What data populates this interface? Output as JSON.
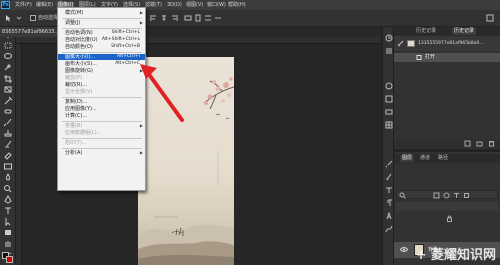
{
  "app": {
    "logo": "Ps"
  },
  "menubar": {
    "items": [
      "文件(F)",
      "编辑(E)",
      "图像(I)",
      "图层(L)",
      "文字(Y)",
      "选择(S)",
      "滤镜(T)",
      "3D(D)",
      "视图(V)",
      "窗口(W)",
      "帮助(H)"
    ],
    "active_index": 2
  },
  "options_bar": {
    "auto_select_label": "自动选择"
  },
  "document": {
    "tab_title": "8365577e81af96633..."
  },
  "image_menu": {
    "items": [
      {
        "label": "模式(M)",
        "shortcut": "",
        "submenu": true,
        "disabled": false
      },
      {
        "separator": true
      },
      {
        "label": "调整(J)",
        "shortcut": "",
        "submenu": true,
        "disabled": false
      },
      {
        "separator": true
      },
      {
        "label": "自动色调(N)",
        "shortcut": "Shift+Ctrl+L",
        "disabled": false
      },
      {
        "label": "自动对比度(U)",
        "shortcut": "Alt+Shift+Ctrl+L",
        "disabled": false
      },
      {
        "label": "自动颜色(O)",
        "shortcut": "Shift+Ctrl+B",
        "disabled": false
      },
      {
        "separator": true
      },
      {
        "label": "图像大小(I)...",
        "shortcut": "Alt+Ctrl+I",
        "disabled": false,
        "highlighted": true
      },
      {
        "label": "画布大小(S)...",
        "shortcut": "Alt+Ctrl+C",
        "disabled": false
      },
      {
        "label": "图像旋转(G)",
        "shortcut": "",
        "submenu": true,
        "disabled": false
      },
      {
        "label": "裁剪(P)",
        "shortcut": "",
        "disabled": true
      },
      {
        "label": "裁切(R)...",
        "shortcut": "",
        "disabled": false
      },
      {
        "label": "显示全部(V)",
        "shortcut": "",
        "disabled": true
      },
      {
        "separator": true
      },
      {
        "label": "复制(D)...",
        "shortcut": "",
        "disabled": false
      },
      {
        "label": "应用图像(Y)...",
        "shortcut": "",
        "disabled": false
      },
      {
        "label": "计算(C)...",
        "shortcut": "",
        "disabled": false
      },
      {
        "separator": true
      },
      {
        "label": "变量(B)",
        "shortcut": "",
        "submenu": true,
        "disabled": true
      },
      {
        "label": "应用数据组(L)...",
        "shortcut": "",
        "disabled": true
      },
      {
        "separator": true
      },
      {
        "label": "陷印(T)...",
        "shortcut": "",
        "disabled": true
      },
      {
        "separator": true
      },
      {
        "label": "分析(A)",
        "shortcut": "",
        "submenu": true,
        "disabled": false
      }
    ]
  },
  "history_panel": {
    "tabs": [
      "历史记录",
      "历史记录"
    ],
    "snapshot_name": "1335555977e81af965b8a0...",
    "states": [
      "打开"
    ]
  },
  "layers_panel": {
    "tabs": [
      "图层",
      "通道",
      "路径"
    ],
    "layer_name": "背景"
  },
  "watermark": "+ 菱耀知识网"
}
